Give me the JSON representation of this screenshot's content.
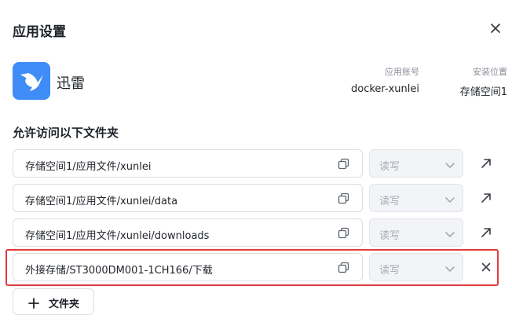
{
  "dialog": {
    "title": "应用设置",
    "close_icon": "close-icon"
  },
  "app": {
    "name": "迅雷",
    "icon": "xunlei-bird-logo",
    "icon_color": "#3f8cf6",
    "account_label": "应用账号",
    "account_value": "docker-xunlei",
    "location_label": "安装位置",
    "location_value": "存储空间1"
  },
  "folders": {
    "section_title": "允许访问以下文件夹",
    "rows": [
      {
        "path": "存储空间1/应用文件/xunlei",
        "permission": "读写",
        "action_icon": "external-link-icon"
      },
      {
        "path": "存储空间1/应用文件/xunlei/data",
        "permission": "读写",
        "action_icon": "external-link-icon"
      },
      {
        "path": "存储空间1/应用文件/xunlei/downloads",
        "permission": "读写",
        "action_icon": "external-link-icon"
      },
      {
        "path": "外接存储/ST3000DM001-1CH166/下载",
        "permission": "读写",
        "action_icon": "remove-icon"
      }
    ],
    "add_button_label": "文件夹",
    "highlight_color": "#e23b3b"
  }
}
